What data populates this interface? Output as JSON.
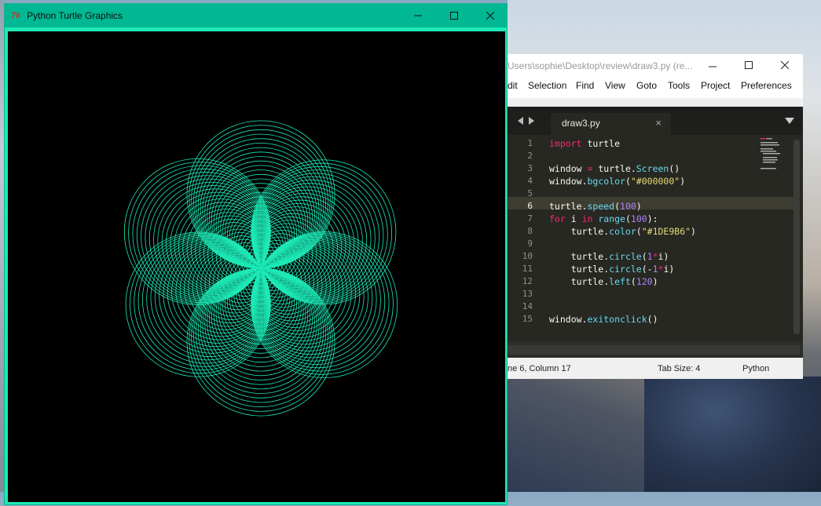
{
  "turtle_window": {
    "title": "Python Turtle Graphics",
    "background": "#000000",
    "pen_color": "#1DE9B6",
    "loop_count": 100,
    "turn_angle": 120
  },
  "editor_window": {
    "title": "Users\\sophie\\Desktop\\review\\draw3.py (re...",
    "menu": [
      "dit",
      "Selection",
      "Find",
      "View",
      "Goto",
      "Tools",
      "Project",
      "Preferences"
    ],
    "tab_label": "draw3.py",
    "tab_close": "×",
    "lines": [
      {
        "no": "1",
        "code": "import turtle"
      },
      {
        "no": "2",
        "code": ""
      },
      {
        "no": "3",
        "code": "window = turtle.Screen()"
      },
      {
        "no": "4",
        "code": "window.bgcolor(\"#000000\")"
      },
      {
        "no": "5",
        "code": ""
      },
      {
        "no": "6",
        "code": "turtle.speed(100)"
      },
      {
        "no": "7",
        "code": "for i in range(100):"
      },
      {
        "no": "8",
        "code": "    turtle.color(\"#1DE9B6\")"
      },
      {
        "no": "9",
        "code": ""
      },
      {
        "no": "10",
        "code": "    turtle.circle(1*i)"
      },
      {
        "no": "11",
        "code": "    turtle.circle(-1*i)"
      },
      {
        "no": "12",
        "code": "    turtle.left(120)"
      },
      {
        "no": "13",
        "code": ""
      },
      {
        "no": "14",
        "code": ""
      },
      {
        "no": "15",
        "code": "window.exitonclick()"
      }
    ],
    "status": {
      "position": "ne 6, Column 17",
      "tab_size": "Tab Size: 4",
      "syntax": "Python"
    }
  }
}
